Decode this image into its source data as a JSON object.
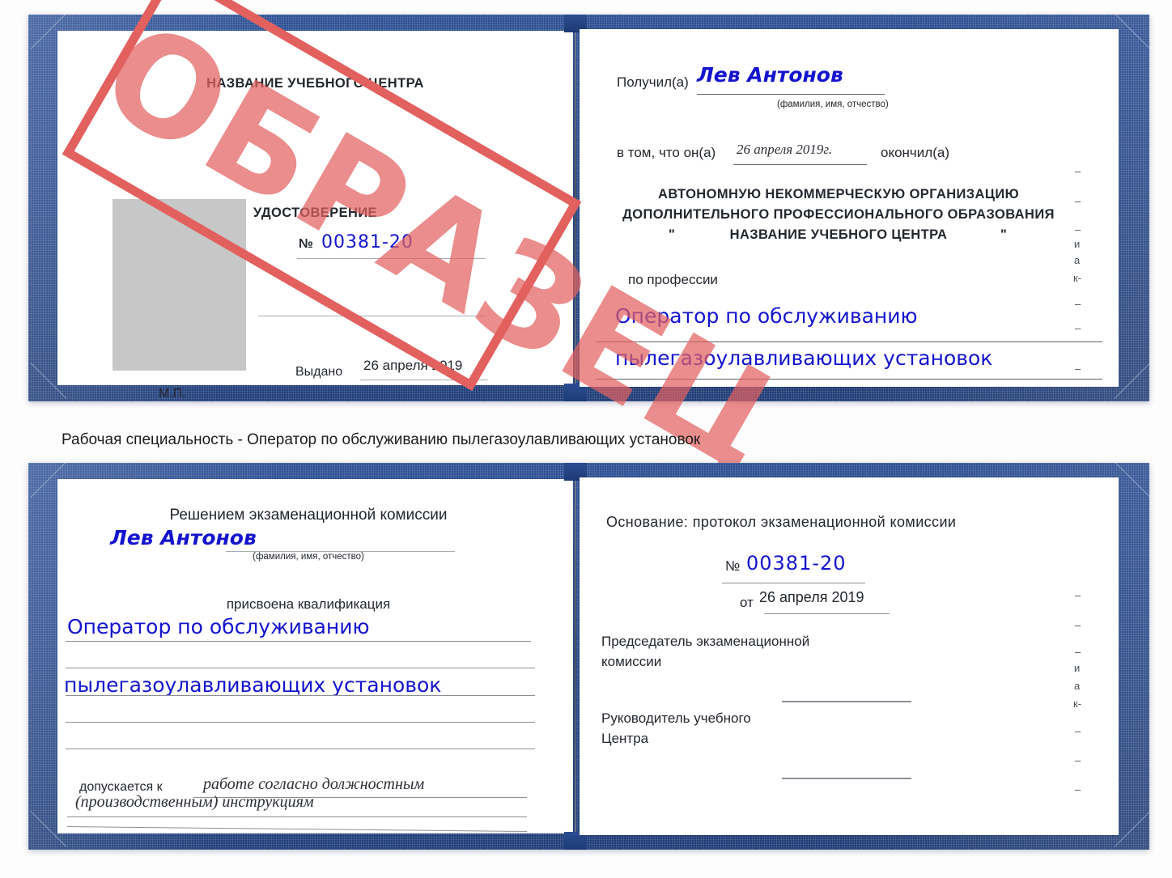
{
  "document": {
    "type": "certificate-scan",
    "colors": {
      "cover_blue": "#274a8d",
      "handwriting_blue": "#1414cf",
      "stamp_red": "#e2615f",
      "photo_placeholder_gray": "#c7c7c7",
      "page_white": "#ffffff",
      "text_dark": "#23272e"
    },
    "stamp": {
      "text": "ОБРАЗЕЦ"
    }
  },
  "caption": {
    "text": "Рабочая специальность - Оператор по обслуживанию пылегазоулавливающих установок"
  },
  "cert_top": {
    "left_page": {
      "center_name": "НАЗВАНИЕ УЧЕБНОГО ЦЕНТРА",
      "doc_title": "УДОСТОВЕРЕНИЕ",
      "number_label": "№",
      "number_value": "00381-20",
      "issued_label": "Выдано",
      "issued_value": "26 апреля 2019",
      "seal_label": "М.П."
    },
    "right_page": {
      "received_label": "Получил(а)",
      "received_value": "Лев Антонов",
      "fio_hint": "(фамилия, имя, отчество)",
      "fact_label": "в том, что он(а)",
      "fact_date": "26 апреля 2019г.",
      "fact_suffix": "окончил(а)",
      "org_line1": "АВТОНОМНУЮ НЕКОММЕРЧЕСКУЮ ОРГАНИЗАЦИЮ",
      "org_line2": "ДОПОЛНИТЕЛЬНОГО ПРОФЕССИОНАЛЬНОГО ОБРАЗОВАНИЯ",
      "org_quote_open": "\"",
      "org_line3": "НАЗВАНИЕ УЧЕБНОГО ЦЕНТРА",
      "org_quote_close": "\"",
      "profession_label": "по профессии",
      "profession_line1": "Оператор по обслуживанию",
      "profession_line2": "пылегазоулавливающих установок",
      "edge_marks": [
        "–",
        "–",
        "–",
        "и",
        "а",
        "к-",
        "–",
        "–",
        "–"
      ]
    }
  },
  "cert_bottom": {
    "left_page": {
      "heading": "Решением экзаменационной комиссии",
      "name_value": "Лев Антонов",
      "fio_hint": "(фамилия, имя, отчество)",
      "qualification_label": "присвоена квалификация",
      "qualification_line1": "Оператор по обслуживанию",
      "qualification_line2": "пылегазоулавливающих установок",
      "admitted_label": "допускается к",
      "admitted_line1": "работе согласно должностным",
      "admitted_line2": "(производственным) инструкциям"
    },
    "right_page": {
      "basis_label": "Основание: протокол экзаменационной комиссии",
      "number_label": "№",
      "number_value": "00381-20",
      "date_label": "от",
      "date_value": "26 апреля 2019",
      "chairman_line1": "Председатель экзаменационной",
      "chairman_line2": "комиссии",
      "head_line1": "Руководитель учебного",
      "head_line2": "Центра",
      "edge_marks": [
        "–",
        "–",
        "–",
        "и",
        "а",
        "к-",
        "–",
        "–",
        "–"
      ]
    }
  }
}
